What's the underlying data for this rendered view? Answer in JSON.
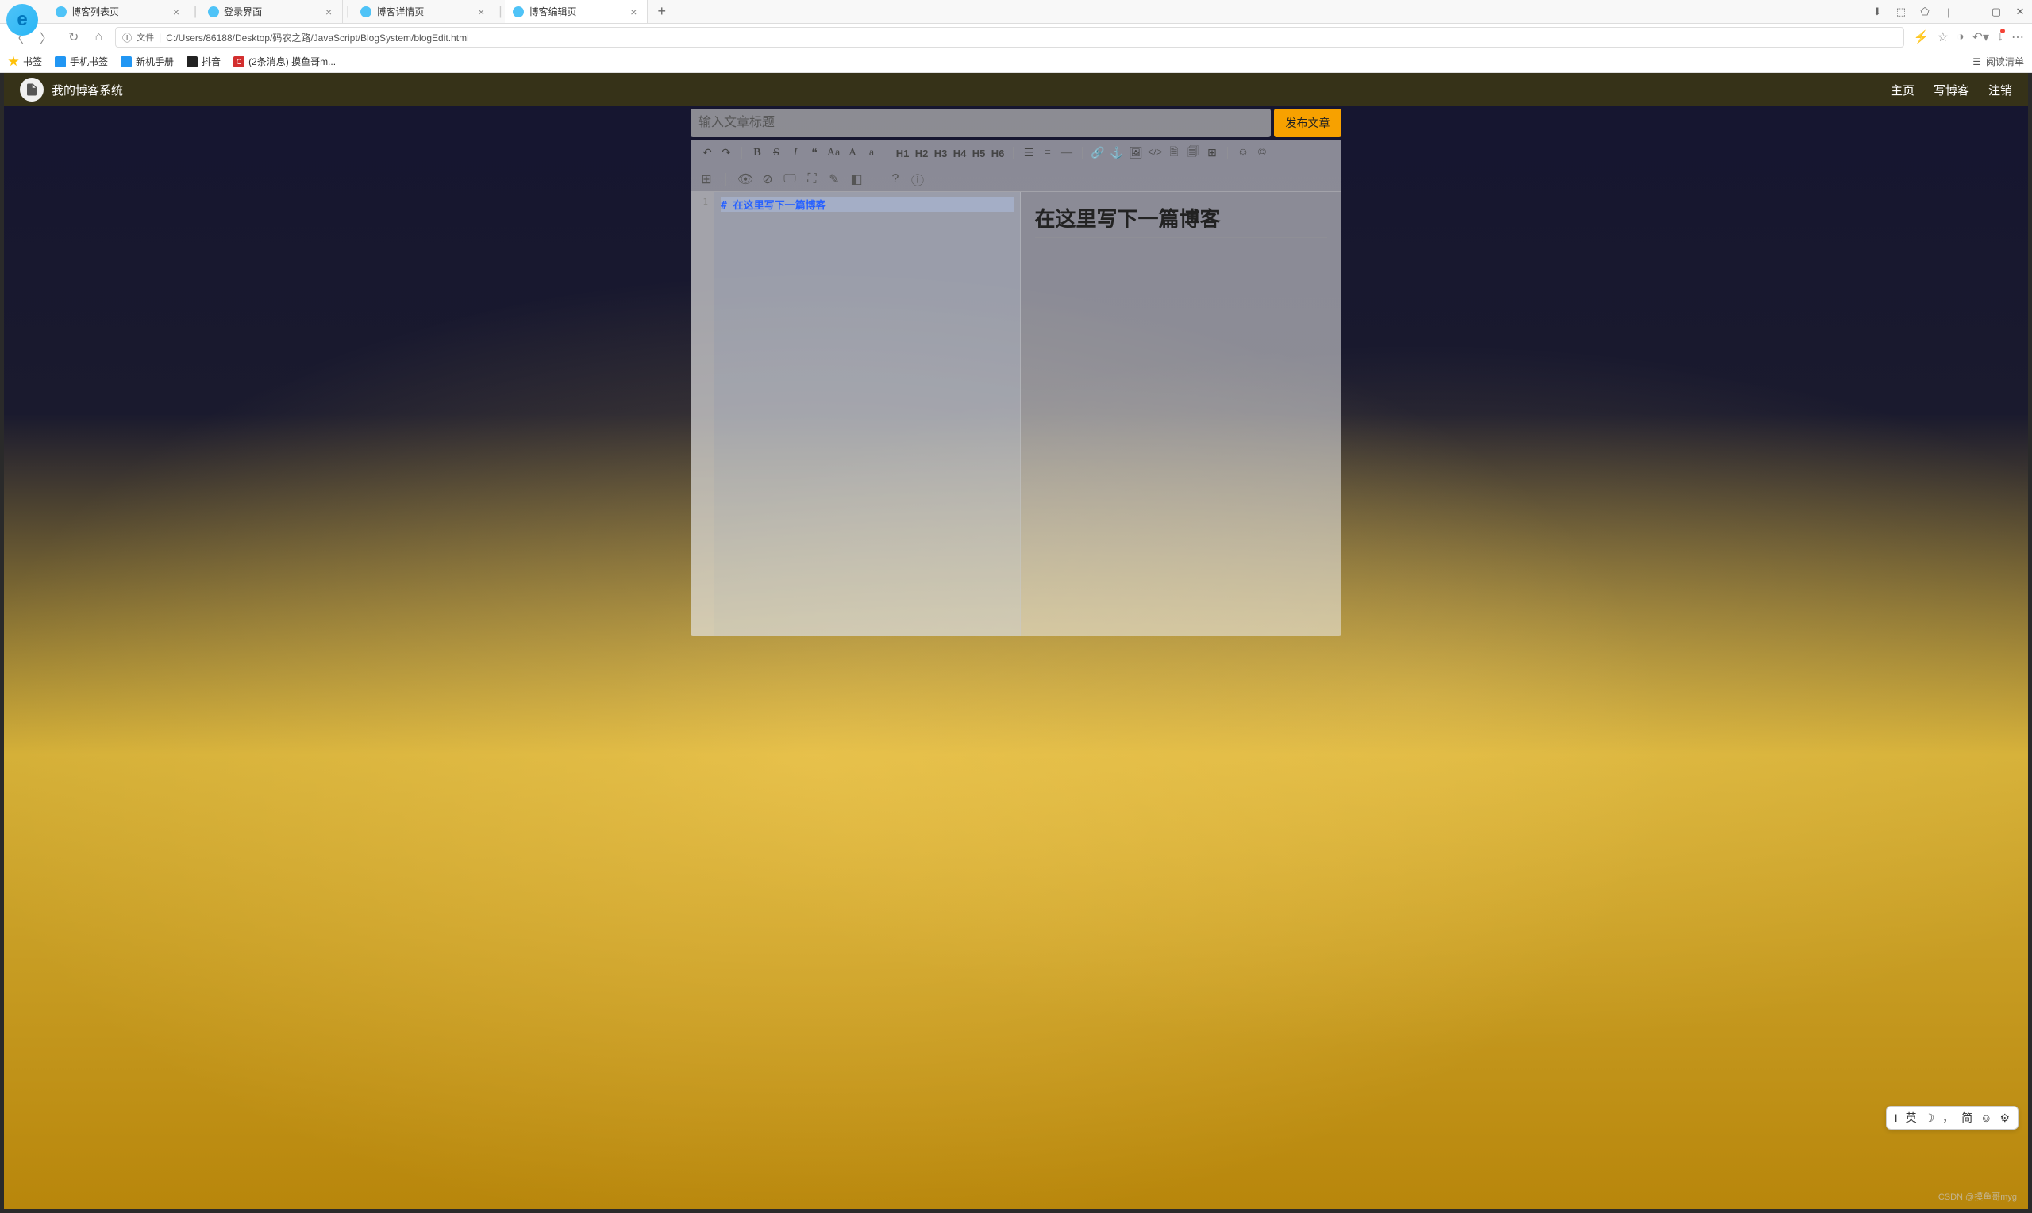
{
  "browser": {
    "tabs": [
      {
        "title": "博客列表页"
      },
      {
        "title": "登录界面"
      },
      {
        "title": "博客详情页"
      },
      {
        "title": "博客编辑页"
      }
    ],
    "url_prefix": "文件",
    "url": "C:/Users/86188/Desktop/码农之路/JavaScript/BlogSystem/blogEdit.html",
    "bookmarks": [
      {
        "label": "书签"
      },
      {
        "label": "手机书签"
      },
      {
        "label": "新机手册"
      },
      {
        "label": "抖音"
      },
      {
        "label": "(2条消息) 摸鱼哥m..."
      }
    ],
    "reading_list": "阅读清单"
  },
  "site": {
    "title": "我的博客系统",
    "nav": {
      "home": "主页",
      "write": "写博客",
      "logout": "注销"
    }
  },
  "editor": {
    "title_placeholder": "输入文章标题",
    "publish": "发布文章",
    "toolbar1": {
      "undo": "↶",
      "redo": "↷",
      "bold": "B",
      "strike": "S",
      "italic": "I",
      "quote": "❝",
      "upper": "Aa",
      "cap_a": "A",
      "low_a": "a",
      "h1": "H1",
      "h2": "H2",
      "h3": "H3",
      "h4": "H4",
      "h5": "H5",
      "h6": "H6",
      "ul": "☰",
      "ol": "≡",
      "hr": "—",
      "link": "🔗",
      "anchor": "⚓",
      "image": "🖼",
      "code": "</>",
      "file": "🗎",
      "doc": "🗐",
      "table": "⊞",
      "emoji": "☺",
      "copyright": "©"
    },
    "toolbar2": {
      "grid": "⊞",
      "eye": "👁",
      "eye2": "⊘",
      "screen": "🖵",
      "expand": "⛶",
      "clear": "✎",
      "erase": "◧",
      "help": "?",
      "info": "ⓘ"
    },
    "line_number": "1",
    "source_content": "# 在这里写下一篇博客",
    "preview_content": "在这里写下一篇博客"
  },
  "ime": {
    "lang": "英",
    "mode": "简",
    "punct": "，",
    "emoji": "☺",
    "gear": "⚙"
  },
  "watermark": "CSDN @摸鱼哥myg"
}
